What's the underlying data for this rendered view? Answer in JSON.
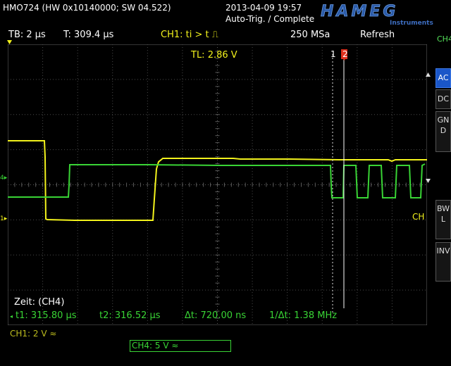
{
  "title": "HMO724 (HW 0x10140000; SW 04.522)",
  "datetime": "2013-04-09 19:57",
  "trigger_status": "Auto-Trig. / Complete",
  "logo": {
    "brand": "HAMEG",
    "sub": "Instruments"
  },
  "status_bar": {
    "timebase": "TB: 2 µs",
    "trig_pos": "T: 309.4 µs",
    "trig_src": "CH1: ti > t ⎍",
    "sample_rate": "250 MSa",
    "mode": "Refresh"
  },
  "trigger_level": "TL:  2.86 V",
  "cursor_labels": {
    "c1": "1",
    "c2": "2"
  },
  "screen_labels": {
    "ch_marker": "CH",
    "zeit": "Zeit: (CH4)"
  },
  "measurements": {
    "t1": "t1: 315.80 µs",
    "t2": "t2: 316.52 µs",
    "dt": "Δt: 720.00 ns",
    "inv_dt": "1/Δt: 1.38 MHz"
  },
  "channels": {
    "ch1": "CH1: 2 V ≈",
    "ch4": "CH4: 5 V ≈"
  },
  "sidebar": {
    "top_label": "CH4",
    "buttons": [
      {
        "label": "AC",
        "active": true
      },
      {
        "label": "DC",
        "active": false
      },
      {
        "label": "GND",
        "active": false
      },
      {
        "label": "BWL",
        "active": false
      },
      {
        "label": "INV",
        "active": false
      }
    ]
  },
  "markers": {
    "ch4": "4",
    "ch1": "1"
  },
  "colors": {
    "ch1": "#f2f21c",
    "ch4": "#39d435",
    "grid": "#5a5a5a",
    "cursor2": "#e0301e",
    "active_button": "#1a56c8"
  }
}
